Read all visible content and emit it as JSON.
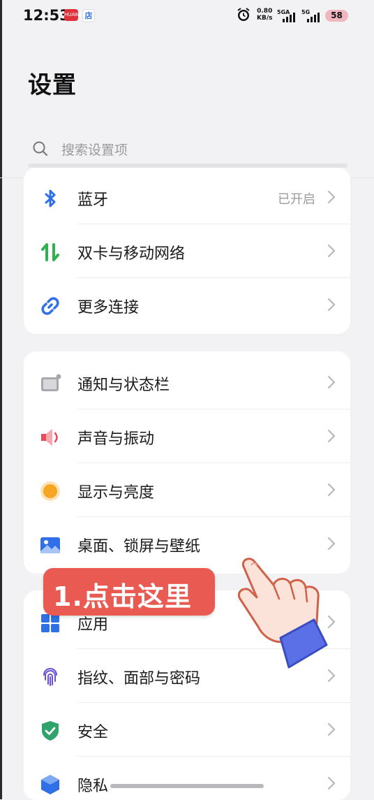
{
  "status_bar": {
    "time": "12:53",
    "red_app_badge": "HUAWEI",
    "blue_app_badge": "店",
    "net_speed_value": "0.80",
    "net_speed_unit": "KB/s",
    "sim1_label": "5GA",
    "sim2_label": "5G",
    "battery": "58"
  },
  "page": {
    "title": "设置"
  },
  "search": {
    "placeholder": "搜索设置项"
  },
  "groups": [
    {
      "items": [
        {
          "label": "蓝牙",
          "value": "已开启",
          "icon": "bluetooth-icon"
        },
        {
          "label": "双卡与移动网络",
          "value": "",
          "icon": "mobile-network-icon"
        },
        {
          "label": "更多连接",
          "value": "",
          "icon": "link-icon"
        }
      ]
    },
    {
      "items": [
        {
          "label": "通知与状态栏",
          "value": "",
          "icon": "notification-icon"
        },
        {
          "label": "声音与振动",
          "value": "",
          "icon": "sound-icon"
        },
        {
          "label": "显示与亮度",
          "value": "",
          "icon": "display-icon"
        },
        {
          "label": "桌面、锁屏与壁纸",
          "value": "",
          "icon": "wallpaper-icon"
        }
      ]
    },
    {
      "items": [
        {
          "label": "应用",
          "value": "",
          "icon": "apps-icon"
        },
        {
          "label": "指纹、面部与密码",
          "value": "",
          "icon": "fingerprint-icon"
        },
        {
          "label": "安全",
          "value": "",
          "icon": "shield-icon"
        },
        {
          "label": "隐私",
          "value": "",
          "icon": "privacy-icon"
        }
      ]
    }
  ],
  "overlay": {
    "callout_text": "1.点击这里"
  },
  "colors": {
    "background": "#f2f2f4",
    "card": "#ffffff",
    "callout": "#e85a52",
    "accent_blue": "#2f6fe8",
    "accent_green": "#2fb150",
    "chevron": "#b8b8b8"
  }
}
